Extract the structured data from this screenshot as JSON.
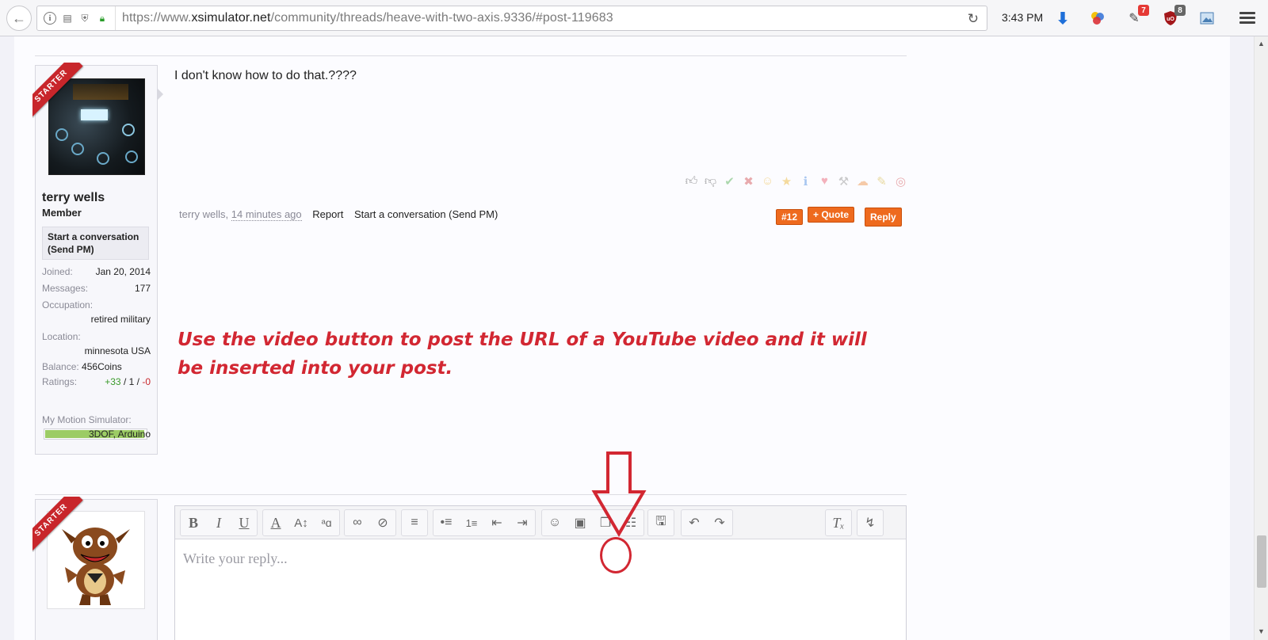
{
  "browser": {
    "url_prefix": "https://www.",
    "url_host": "xsimulator.net",
    "url_path": "/community/threads/heave-with-two-axis.9336/#post-119683",
    "clock": "3:43 PM",
    "badges": {
      "shield_count": "7",
      "ublock_count": "8"
    }
  },
  "post": {
    "starter_ribbon": "STARTER",
    "user": {
      "name": "terry wells",
      "title": "Member",
      "pm_label": "Start a conversation (Send PM)",
      "stats": {
        "joined_label": "Joined:",
        "joined": "Jan 20, 2014",
        "messages_label": "Messages:",
        "messages": "177",
        "occupation_label": "Occupation:",
        "occupation": "retired military",
        "location_label": "Location:",
        "location": "minnesota USA",
        "balance_label": "Balance:",
        "balance": "456Coins",
        "ratings_label": "Ratings:",
        "ratings_pos": "+33",
        "ratings_neutral": "1",
        "ratings_neg": "-0",
        "rating_level": 0.97,
        "sim_label": "My Motion Simulator:",
        "sim": "3DOF, Arduino"
      }
    },
    "message": "I don't know how to do that.????",
    "meta": {
      "author": "terry wells",
      "time": "14 minutes ago",
      "report": "Report",
      "start_conversation": "Start a conversation (Send PM)"
    },
    "buttons": {
      "permalink": "#12",
      "quote": "+ Quote",
      "reply": "Reply"
    }
  },
  "annotation": "Use the video button to post the URL of a YouTube video and it will be inserted into your post.",
  "reply": {
    "starter_ribbon": "STARTER",
    "placeholder": "Write your reply..."
  },
  "colors": {
    "accent": "#ee6a1e",
    "annotation": "#d22732",
    "ribbon": "#c8262b"
  }
}
